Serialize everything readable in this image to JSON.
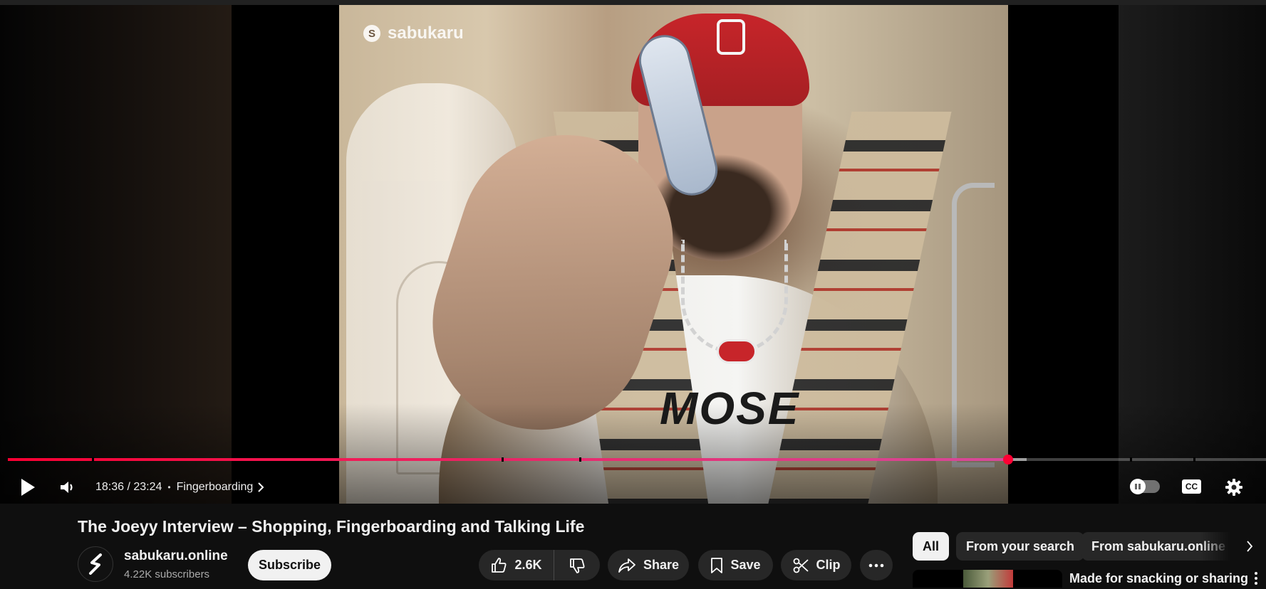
{
  "player": {
    "watermark": "sabukaru",
    "shirt_text": "MOSE",
    "current_time": "18:36",
    "duration": "23:24",
    "time_display": "18:36 / 23:24",
    "chapter_separator": "•",
    "chapter": "Fingerboarding",
    "progress_fraction": 0.795,
    "buffered_fraction": 0.81,
    "colors": {
      "played": "#ff0033",
      "scrubber": "#ff0033"
    },
    "icons": {
      "play": "play-icon",
      "volume": "volume-icon",
      "autoplay": "autoplay-toggle",
      "captions": "cc-icon",
      "settings": "gear-icon",
      "chapter": "chevron-right-icon"
    },
    "captions_label": "CC"
  },
  "video": {
    "title": "The Joeyy Interview – Shopping, Fingerboarding and Talking Life",
    "channel": {
      "name": "sabukaru.online",
      "subscribers": "4.22K subscribers"
    },
    "subscribe_label": "Subscribe",
    "actions": {
      "like_count": "2.6K",
      "share_label": "Share",
      "save_label": "Save",
      "clip_label": "Clip"
    }
  },
  "sidebar": {
    "chips": [
      {
        "label": "All",
        "active": true
      },
      {
        "label": "From your search",
        "active": false
      },
      {
        "label": "From sabukaru.online",
        "active": false
      }
    ],
    "recommendation": {
      "title": "Made for snacking or sharing"
    }
  }
}
